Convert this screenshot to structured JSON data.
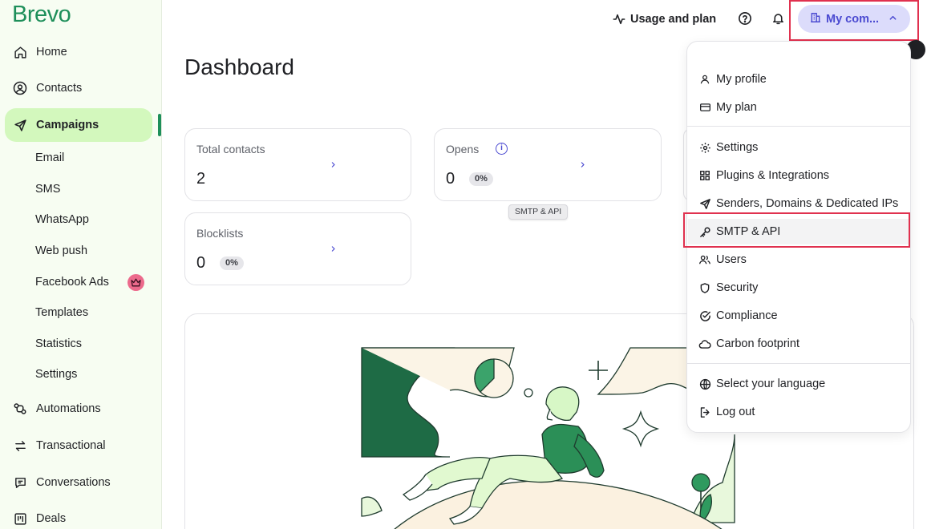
{
  "brand": {
    "logo_text": "Brevo",
    "accent_color": "#1e8f5a",
    "highlight_color": "#e0314f"
  },
  "sidebar": {
    "items": [
      {
        "label": "Home",
        "icon": "home-icon"
      },
      {
        "label": "Contacts",
        "icon": "contacts-icon"
      },
      {
        "label": "Campaigns",
        "icon": "send-icon",
        "active": true
      },
      {
        "label": "Automations",
        "icon": "automations-icon"
      },
      {
        "label": "Transactional",
        "icon": "transactional-icon"
      },
      {
        "label": "Conversations",
        "icon": "conversations-icon"
      },
      {
        "label": "Deals",
        "icon": "deals-icon"
      }
    ],
    "campaign_sub_items": [
      "Email",
      "SMS",
      "WhatsApp",
      "Web push",
      "Facebook Ads",
      "Templates",
      "Statistics",
      "Settings"
    ]
  },
  "header": {
    "usage_label": "Usage and plan",
    "company_label": "My com...",
    "help_icon": "help-icon",
    "bell_icon": "bell-icon"
  },
  "main": {
    "title": "Dashboard",
    "cards": {
      "total_contacts": {
        "label": "Total contacts",
        "value": "2"
      },
      "opens": {
        "label": "Opens",
        "value": "0",
        "percent": "0%"
      },
      "blocklists": {
        "label": "Blocklists",
        "value": "0",
        "percent": "0%"
      }
    },
    "tooltip": "SMTP & API"
  },
  "dropdown": {
    "items": [
      {
        "label": "My profile",
        "icon": "user-icon"
      },
      {
        "label": "My plan",
        "icon": "card-icon"
      },
      {
        "label": "Settings",
        "icon": "gear-icon"
      },
      {
        "label": "Plugins & Integrations",
        "icon": "grid-icon"
      },
      {
        "label": "Senders, Domains & Dedicated IPs",
        "icon": "send-icon"
      },
      {
        "label": "SMTP & API",
        "icon": "key-icon",
        "highlighted": true
      },
      {
        "label": "Users",
        "icon": "users-icon"
      },
      {
        "label": "Security",
        "icon": "shield-icon"
      },
      {
        "label": "Compliance",
        "icon": "check-circle-icon"
      },
      {
        "label": "Carbon footprint",
        "icon": "cloud-icon"
      },
      {
        "label": "Select your language",
        "icon": "globe-icon"
      },
      {
        "label": "Log out",
        "icon": "logout-icon"
      }
    ]
  }
}
